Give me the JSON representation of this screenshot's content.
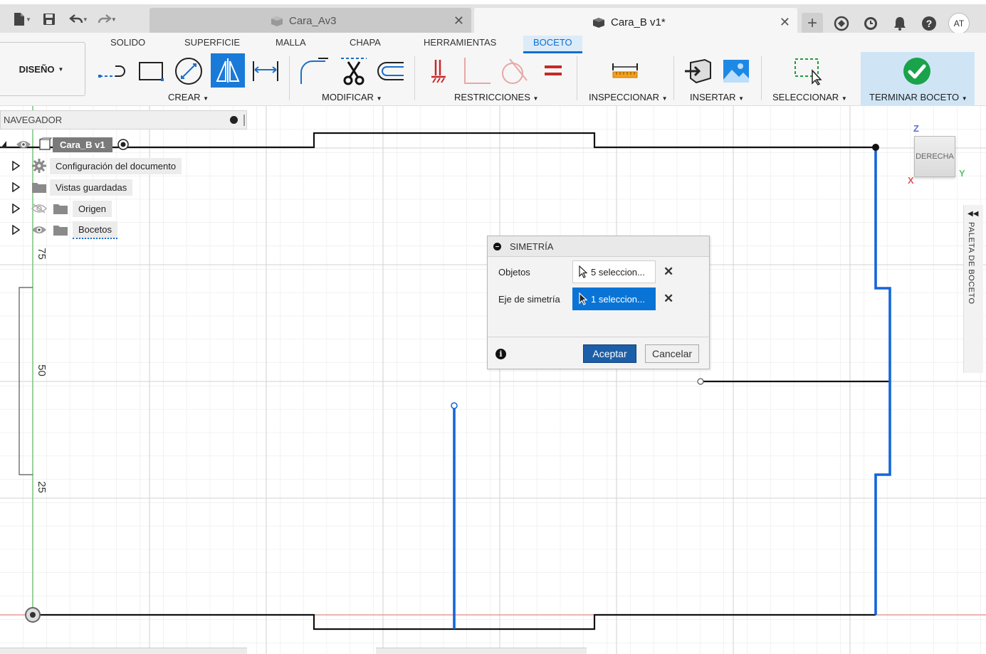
{
  "app": {
    "quick_access": {
      "file_icon": "file-icon",
      "save_icon": "save-icon",
      "undo_icon": "undo-icon",
      "redo_icon": "redo-icon"
    },
    "tabs": [
      {
        "label": "Cara_Av3",
        "icon": "component-icon",
        "active": false
      },
      {
        "label": "Cara_B v1*",
        "icon": "component-icon",
        "active": true
      }
    ],
    "avatar_initials": "AT"
  },
  "toolbar": {
    "workspace_tabs": [
      "SOLIDO",
      "SUPERFICIE",
      "MALLA",
      "CHAPA",
      "HERRAMIENTAS",
      "BOCETO"
    ],
    "active_workspace": "BOCETO",
    "design_button": "DISEÑO",
    "groups": {
      "crear": "CREAR",
      "modificar": "MODIFICAR",
      "restricciones": "RESTRICCIONES",
      "inspeccionar": "INSPECCIONAR",
      "insertar": "INSERTAR",
      "seleccionar": "SELECCIONAR",
      "terminar": "TERMINAR BOCETO"
    }
  },
  "navigator": {
    "title": "NAVEGADOR",
    "root": "Cara_B v1",
    "items": [
      {
        "label": "Configuración del documento",
        "icon": "gear-icon"
      },
      {
        "label": "Vistas guardadas",
        "icon": "folder-icon"
      },
      {
        "label": "Origen",
        "icon": "folder-icon",
        "hidden": true
      },
      {
        "label": "Bocetos",
        "icon": "folder-icon"
      }
    ]
  },
  "dialog": {
    "title": "SIMETRÍA",
    "rows": [
      {
        "label": "Objetos",
        "value": "5 seleccion...",
        "active": false
      },
      {
        "label": "Eje de simetría",
        "value": "1 seleccion...",
        "active": true
      }
    ],
    "ok_label": "Aceptar",
    "cancel_label": "Cancelar"
  },
  "viewcube": {
    "face_label": "DERECHA",
    "axes": {
      "z": "Z",
      "y": "Y",
      "x": "X"
    }
  },
  "palette": {
    "label": "PALETA DE BOCETO"
  },
  "ruler": {
    "labels": [
      "75",
      "50",
      "25"
    ]
  },
  "colors": {
    "accent": "#0a6fd1",
    "sketch_selected": "#1565d8",
    "sketch_line": "#111111",
    "finish_green": "#1aa34a"
  }
}
